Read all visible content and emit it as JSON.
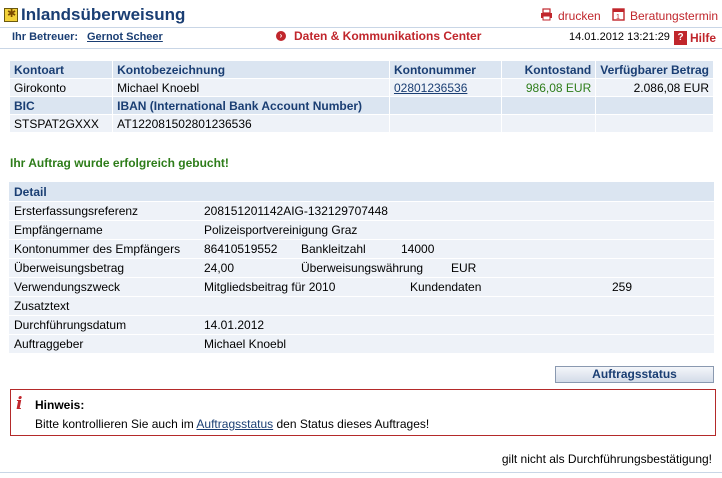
{
  "header": {
    "title": "Inlandsüberweisung",
    "print_label": "drucken",
    "appointment_label": "Beratungstermin"
  },
  "subheader": {
    "advisor_label": "Ihr Betreuer:",
    "advisor_name": "Gernot Scheer",
    "center_label": "Daten & Kommunikations Center",
    "datetime": "14.01.2012 13:21:29",
    "help_label": "Hilfe"
  },
  "account": {
    "headers": [
      "Kontoart",
      "Kontobezeichnung",
      "Kontonummer",
      "Kontostand",
      "Verfügbarer Betrag"
    ],
    "row": [
      "Girokonto",
      "Michael Knoebl",
      "02801236536",
      "986,08 EUR",
      "2.086,08 EUR"
    ],
    "headers2": [
      "BIC",
      "IBAN (International Bank Account Number)"
    ],
    "row2": [
      "STSPAT2GXXX",
      "AT122081502801236536"
    ]
  },
  "success_message": "Ihr Auftrag wurde erfolgreich gebucht!",
  "detail": {
    "header": "Detail",
    "ref_label": "Ersterfassungsreferenz",
    "ref_value": "208151201142AIG-132129707448",
    "payee_label": "Empfängername",
    "payee_value": "Polizeisportvereinigung Graz",
    "acct_label": "Kontonummer des Empfängers",
    "acct_value": "86410519552",
    "blz_label": "Bankleitzahl",
    "blz_value": "14000",
    "amount_label": "Überweisungsbetrag",
    "amount_value": "24,00",
    "currency_label": "Überweisungswährung",
    "currency_value": "EUR",
    "purpose_label": "Verwendungszweck",
    "purpose_value": "Mitgliedsbeitrag für 2010",
    "customer_label": "Kundendaten",
    "customer_value": "259",
    "extra_label": "Zusatztext",
    "date_label": "Durchführungsdatum",
    "date_value": "14.01.2012",
    "orderer_label": "Auftraggeber",
    "orderer_value": "Michael Knoebl"
  },
  "status_button": "Auftragsstatus",
  "notice": {
    "title": "Hinweis:",
    "text_before": "Bitte kontrollieren Sie auch im ",
    "link": "Auftragsstatus",
    "text_after": " den Status dieses Auftrages!"
  },
  "footer_note": "gilt nicht als Durchführungsbestätigung!"
}
